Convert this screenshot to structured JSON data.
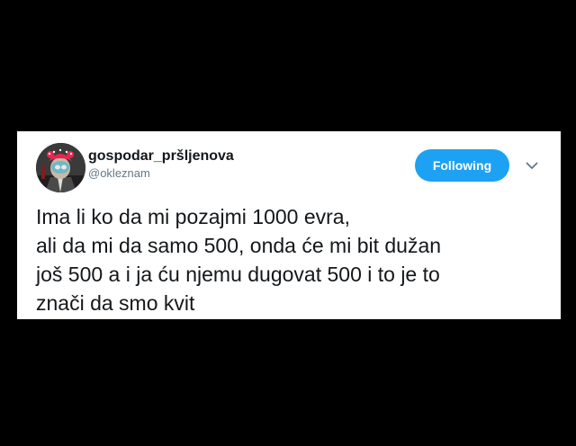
{
  "tweet": {
    "author": {
      "display_name": "gospodar_pršljenova",
      "handle": "@okleznam",
      "avatar_icon": "profile-avatar"
    },
    "follow_button": {
      "label": "Following",
      "color": "#1da1f2"
    },
    "menu_icon": "chevron-down-icon",
    "text_lines": [
      "Ima li ko da mi pozajmi 1000 evra,",
      "ali da mi da samo 500, onda će mi bit dužan",
      "još 500 a i ja ću njemu dugovat 500 i to je to",
      "znači da smo kvit"
    ]
  },
  "colors": {
    "background": "#000000",
    "card": "#ffffff",
    "text": "#14171a",
    "muted": "#657786",
    "accent": "#1da1f2"
  }
}
